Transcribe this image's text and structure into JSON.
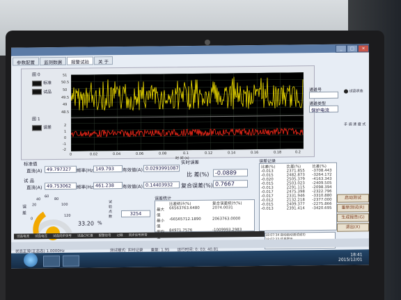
{
  "window": {
    "tabs": [
      "参数配置",
      "监测数据",
      "报警试验",
      "关 于"
    ]
  },
  "legend": {
    "group0": "图 0",
    "item_std": "标准",
    "item_test": "试品",
    "group1": "图 1",
    "item_diff": "误差"
  },
  "plot": {
    "y_ticks_top": [
      "51",
      "50.5",
      "50",
      "49.5",
      "49",
      "48.5"
    ],
    "y_ticks_bottom": [
      "2",
      "1",
      "0",
      "-1",
      "-2"
    ],
    "x_ticks": [
      "0",
      "0.02",
      "0.04",
      "0.06",
      "0.08",
      "0.1",
      "0.12",
      "0.14",
      "0.16",
      "0.18",
      "0.2"
    ],
    "x_label": "时 间 (s)"
  },
  "side": {
    "label1": "通道号",
    "label2": "通道类型",
    "select_value": "保护电流",
    "switch_label": "试品状态",
    "mode_label": "手 调 速 度 式"
  },
  "readings": {
    "std_group": "标准值",
    "std_label": "直流(A)",
    "std_value": "49.797327",
    "freq_label": "频率(Hz)",
    "std_freq": "149.793",
    "eff_label": "有效值(A)",
    "std_eff": "0.0293991087",
    "test_group": "试 品",
    "test_label": "直流(A)",
    "test_value": "49.753062",
    "test_freq": "461.238",
    "test_eff": "0.14403932",
    "realtime": "实时误差",
    "ratio_label": "比 差(%)",
    "ratio_value": "-0.0889",
    "comp_label": "复合误差(%)",
    "comp_value": "0.7667"
  },
  "gauge": {
    "ticks": [
      "0",
      "20",
      "40",
      "60",
      "80",
      "100",
      "120"
    ],
    "value_text": "33.20",
    "unit": "%",
    "left_label": "误 差",
    "mid_label": "试 验 点 数",
    "count": "3254"
  },
  "stats": {
    "title": "误差统计",
    "headers": [
      "",
      "比差统计(%)",
      "复合误差统计(%)"
    ],
    "rows": [
      [
        "最大值",
        "66563763.6480",
        "2074.0031"
      ],
      [
        "最小值",
        "-66565712.1890",
        "2063763.0000"
      ],
      [
        "平均值",
        "84971.7576",
        "-1009993.2983"
      ]
    ]
  },
  "record": {
    "title": "误差记录",
    "headers": [
      "比差(%)",
      "比差(%)",
      "比差(%)"
    ],
    "rows": [
      [
        "-0.013",
        "2371.855",
        "-3708.443"
      ],
      [
        "-0.015",
        "2482.873",
        "-3264.172"
      ],
      [
        "-0.020",
        "2505.379",
        "-4163.343"
      ],
      [
        "-0.015",
        "2503.023",
        "-2409.505"
      ],
      [
        "-0.013",
        "2291.115",
        "-2098.394"
      ],
      [
        "-0.017",
        "2475.398",
        "-2322.796"
      ],
      [
        "-0.017",
        "2331.946",
        "-3310.880"
      ],
      [
        "-0.012",
        "2132.218",
        "-2377.000"
      ],
      [
        "-0.015",
        "2409.377",
        "-2275.866"
      ],
      [
        "-0.013",
        "2391.414",
        "-3420.695"
      ]
    ]
  },
  "buttons": [
    "启动测试",
    "重新测试(R)",
    "生成报告(G)",
    "退出(X)"
  ],
  "legend_bar": [
    "试品电流",
    "试品电压",
    "试品同步信号",
    "试品CRC值",
    "报警信号",
    "过载",
    "同步信号异常"
  ],
  "status": {
    "left": "状态正常(正态态) 1.0000Hz",
    "mid": "测试模式: 实时记录",
    "rate": "重复: 1.95",
    "run": "运行时间: 0: 03: 40.81"
  },
  "log": [
    "18:07:34 自动启动测试成功",
    "18:07:33 信息提示",
    "18:07:34 启动成功"
  ],
  "taskbar": {
    "time": "18:41",
    "date": "2015/12/01"
  }
}
